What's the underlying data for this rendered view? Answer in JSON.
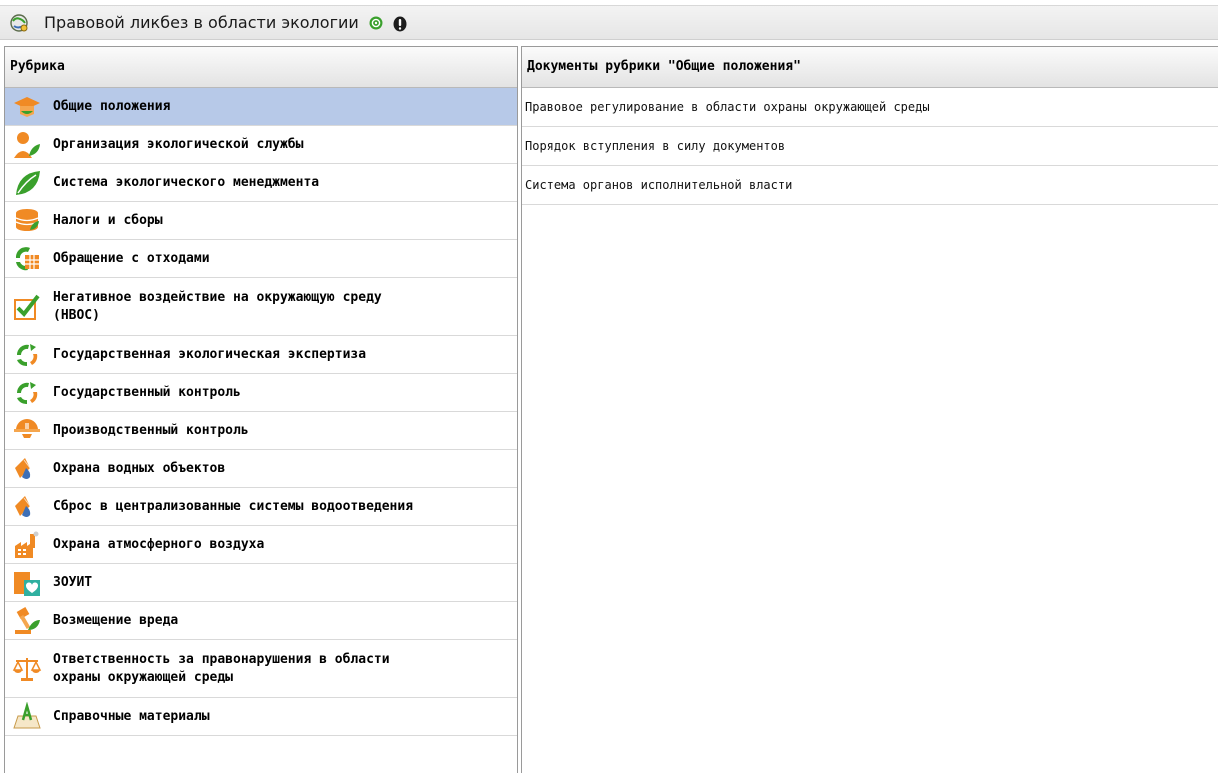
{
  "window": {
    "title": "Правовой ликбез в области экологии",
    "icons": [
      "app-globe-icon",
      "help-icon",
      "info-icon"
    ]
  },
  "left": {
    "header": "Рубрика",
    "items": [
      {
        "label": "Общие положения",
        "icon": "graduation-cap-icon",
        "selected": true
      },
      {
        "label": "Организация экологической службы",
        "icon": "person-leaf-icon"
      },
      {
        "label": "Система экологического менеджмента",
        "icon": "leaf-icon"
      },
      {
        "label": "Налоги и сборы",
        "icon": "coins-icon"
      },
      {
        "label": "Обращение с отходами",
        "icon": "recycle-box-icon"
      },
      {
        "label": "Негативное воздействие на окружающую среду\n(НВОС)",
        "icon": "checkmark-icon"
      },
      {
        "label": "Государственная экологическая экспертиза",
        "icon": "recycle-icon"
      },
      {
        "label": "Государственный контроль",
        "icon": "recycle-icon"
      },
      {
        "label": "Производственный контроль",
        "icon": "helmet-icon"
      },
      {
        "label": "Охрана водных объектов",
        "icon": "water-drop-icon"
      },
      {
        "label": "Сброс в централизованные системы водоотведения",
        "icon": "water-drop-icon"
      },
      {
        "label": "Охрана атмосферного воздуха",
        "icon": "factory-icon"
      },
      {
        "label": "ЗОУИТ",
        "icon": "zone-icon"
      },
      {
        "label": "Возмещение вреда",
        "icon": "gavel-icon"
      },
      {
        "label": "Ответственность за правонарушения в области\nохраны окружающей среды",
        "icon": "scales-icon"
      },
      {
        "label": "Справочные материалы",
        "icon": "reference-book-icon"
      }
    ]
  },
  "right": {
    "header": "Документы рубрики \"Общие положения\"",
    "items": [
      {
        "label": "Правовое регулирование в области охраны окружающей среды"
      },
      {
        "label": "Порядок вступления в силу документов"
      },
      {
        "label": "Система органов исполнительной власти"
      }
    ]
  },
  "colors": {
    "selection": "#b7c9e8",
    "icon_orange": "#f08a24",
    "icon_green": "#3aa02c"
  }
}
